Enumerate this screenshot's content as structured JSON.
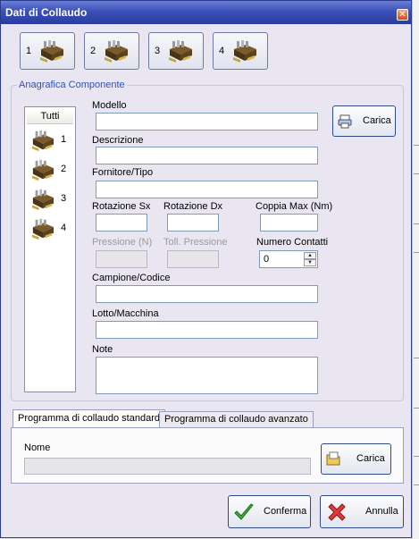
{
  "window": {
    "title": "Dati di Collaudo"
  },
  "toolbar": {
    "buttons": [
      {
        "label": "1",
        "icon": "connector-icon"
      },
      {
        "label": "2",
        "icon": "connector-icon"
      },
      {
        "label": "3",
        "icon": "connector-icon"
      },
      {
        "label": "4",
        "icon": "connector-icon"
      }
    ]
  },
  "anagrafica": {
    "legend": "Anagrafica Componente",
    "list": {
      "header": "Tutti",
      "items": [
        "1",
        "2",
        "3",
        "4"
      ]
    },
    "fields": {
      "modello": {
        "label": "Modello",
        "value": ""
      },
      "descrizione": {
        "label": "Descrizione",
        "value": ""
      },
      "fornitore": {
        "label": "Fornitore/Tipo",
        "value": ""
      },
      "rotazione_sx": {
        "label": "Rotazione Sx",
        "value": ""
      },
      "rotazione_dx": {
        "label": "Rotazione Dx",
        "value": ""
      },
      "coppia_max": {
        "label": "Coppia Max (Nm)",
        "value": ""
      },
      "pressione": {
        "label": "Pressione (N)",
        "value": ""
      },
      "toll_pressione": {
        "label": "Toll. Pressione",
        "value": ""
      },
      "numero_contatti": {
        "label": "Numero Contatti",
        "value": "0"
      },
      "campione": {
        "label": "Campione/Codice",
        "value": ""
      },
      "lotto": {
        "label": "Lotto/Macchina",
        "value": ""
      },
      "note": {
        "label": "Note",
        "value": ""
      }
    },
    "carica_label": "Carica"
  },
  "programma": {
    "tabs": [
      "Programma di collaudo standard",
      "Programma di collaudo avanzato"
    ],
    "nome": {
      "label": "Nome",
      "value": ""
    },
    "carica_label": "Carica"
  },
  "footer": {
    "conferma_label": "Conferma",
    "annulla_label": "Annulla"
  },
  "colors": {
    "title_bar": "#2a3c9e",
    "legend": "#2a52be",
    "accent_border": "#2f4a8b"
  }
}
